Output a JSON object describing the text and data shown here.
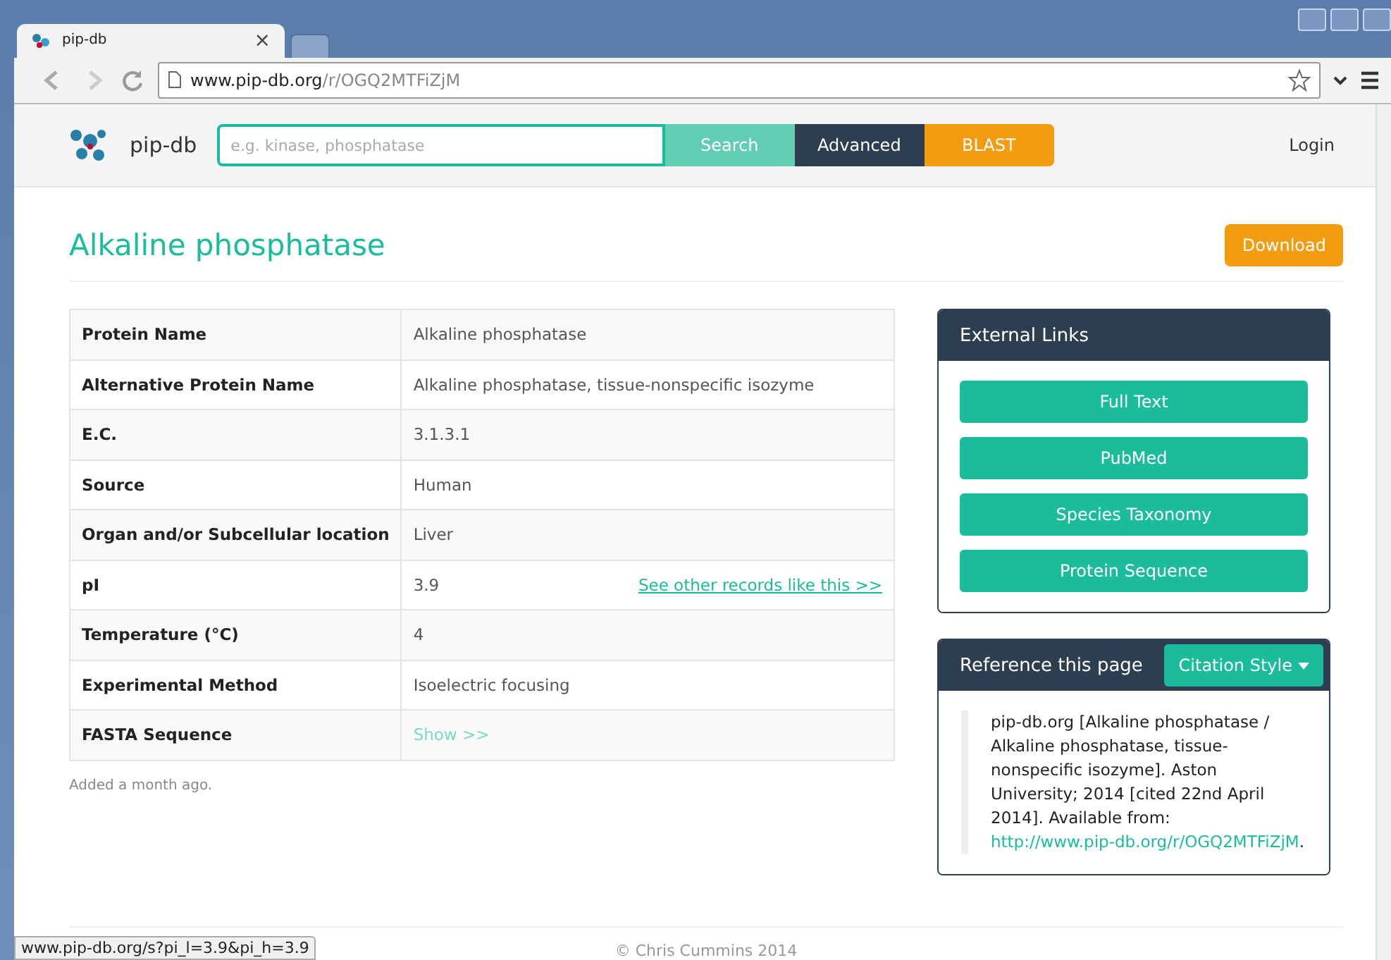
{
  "browser": {
    "tab_title": "pip-db",
    "tab_close": "×",
    "url_host": "www.pip-db.org",
    "url_path": "/r/OGQ2MTFiZjM"
  },
  "navbar": {
    "brand": "pip-db",
    "search_placeholder": "e.g. kinase, phosphatase",
    "buttons": [
      {
        "label": "Search",
        "kind": "search"
      },
      {
        "label": "Advanced",
        "kind": "dark"
      },
      {
        "label": "BLAST",
        "kind": "orange"
      }
    ],
    "login": "Login"
  },
  "page": {
    "title": "Alkaline phosphatase",
    "download": "Download"
  },
  "table": {
    "rows": [
      {
        "label": "Protein Name",
        "value": "Alkaline phosphatase"
      },
      {
        "label": "Alternative Protein Name",
        "value": "Alkaline phosphatase, tissue-nonspecific isozyme"
      },
      {
        "label": "E.C.",
        "value": "3.1.3.1"
      },
      {
        "label": "Source",
        "value": "Human"
      },
      {
        "label": "Organ and/or Subcellular location",
        "value": "Liver"
      },
      {
        "label": "pI",
        "value": "3.9",
        "link": "See other records like this >>"
      },
      {
        "label": "Temperature (°C)",
        "value": "4"
      },
      {
        "label": "Experimental Method",
        "value": "Isoelectric focusing"
      },
      {
        "label": "FASTA Sequence",
        "value": "Show >>",
        "kind": "link"
      }
    ]
  },
  "added": "Added a month ago.",
  "external_links": {
    "title": "External Links",
    "buttons": [
      "Full Text",
      "PubMed",
      "Species Taxonomy",
      "Protein Sequence"
    ]
  },
  "reference": {
    "title": "Reference this page",
    "style_button": "Citation Style",
    "citation": "pip-db.org [Alkaline phosphatase / Alkaline phosphatase, tissue-nonspecific isozyme]. Aston University; 2014 [cited 22nd April 2014]. Available from:",
    "citation_link": "http://www.pip-db.org/r/OGQ2MTFiZjM",
    "citation_end": "."
  },
  "footer": "© Chris Cummins 2014",
  "status_url": "www.pip-db.org/s?pi_l=3.9&pi_h=3.9"
}
